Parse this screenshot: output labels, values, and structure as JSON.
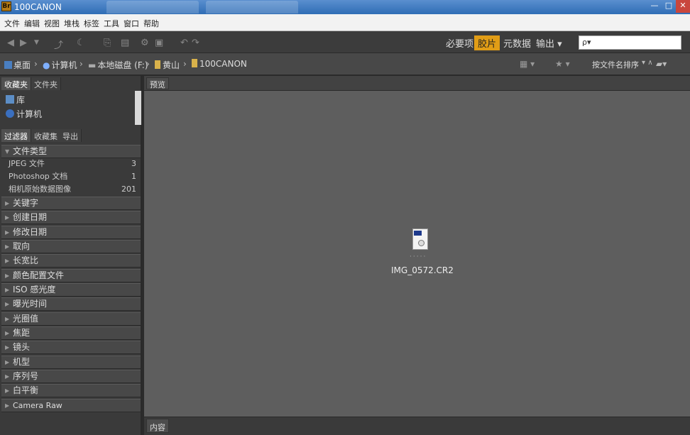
{
  "window": {
    "title": "100CANON",
    "app_icon": "Br"
  },
  "menu": [
    "文件",
    "编辑",
    "视图",
    "堆栈",
    "标签",
    "工具",
    "窗口",
    "帮助"
  ],
  "workspaces": {
    "essentials": "必要项",
    "filmstrip": "胶片",
    "metadata": "元数据",
    "output": "输出 ▾"
  },
  "search": {
    "placeholder": "ρ▾"
  },
  "breadcrumb": [
    {
      "label": "桌面"
    },
    {
      "label": "计算机"
    },
    {
      "label": "本地磁盘 (F:)"
    },
    {
      "label": "黄山"
    },
    {
      "label": "100CANON"
    }
  ],
  "sort_label": "按文件名排序",
  "panels": {
    "top_tabs": [
      "收藏夹",
      "文件夹"
    ],
    "favorites": [
      "库",
      "计算机"
    ],
    "bottom_tabs": [
      "过滤器",
      "收藏集",
      "导出"
    ],
    "filter_groups": [
      {
        "label": "文件类型",
        "expanded": true,
        "rows": [
          {
            "label": "JPEG 文件",
            "count": "3"
          },
          {
            "label": "Photoshop 文档",
            "count": "1"
          },
          {
            "label": "相机原始数据图像",
            "count": "201"
          }
        ]
      },
      {
        "label": "关键字"
      },
      {
        "label": "创建日期"
      },
      {
        "label": "修改日期"
      },
      {
        "label": "取向"
      },
      {
        "label": "长宽比"
      },
      {
        "label": "颜色配置文件"
      },
      {
        "label": "ISO 感光度"
      },
      {
        "label": "曝光时间"
      },
      {
        "label": "光圈值"
      },
      {
        "label": "焦距"
      },
      {
        "label": "镜头"
      },
      {
        "label": "机型"
      },
      {
        "label": "序列号"
      },
      {
        "label": "白平衡"
      },
      {
        "label": "Camera Raw"
      }
    ]
  },
  "content": {
    "tab": "预览",
    "bottom_tab": "内容",
    "file": {
      "name": "IMG_0572.CR2",
      "icon": "cr2-file-icon"
    }
  },
  "colors": {
    "accent": "#e19d16",
    "title_bar": "#2f6db5"
  }
}
